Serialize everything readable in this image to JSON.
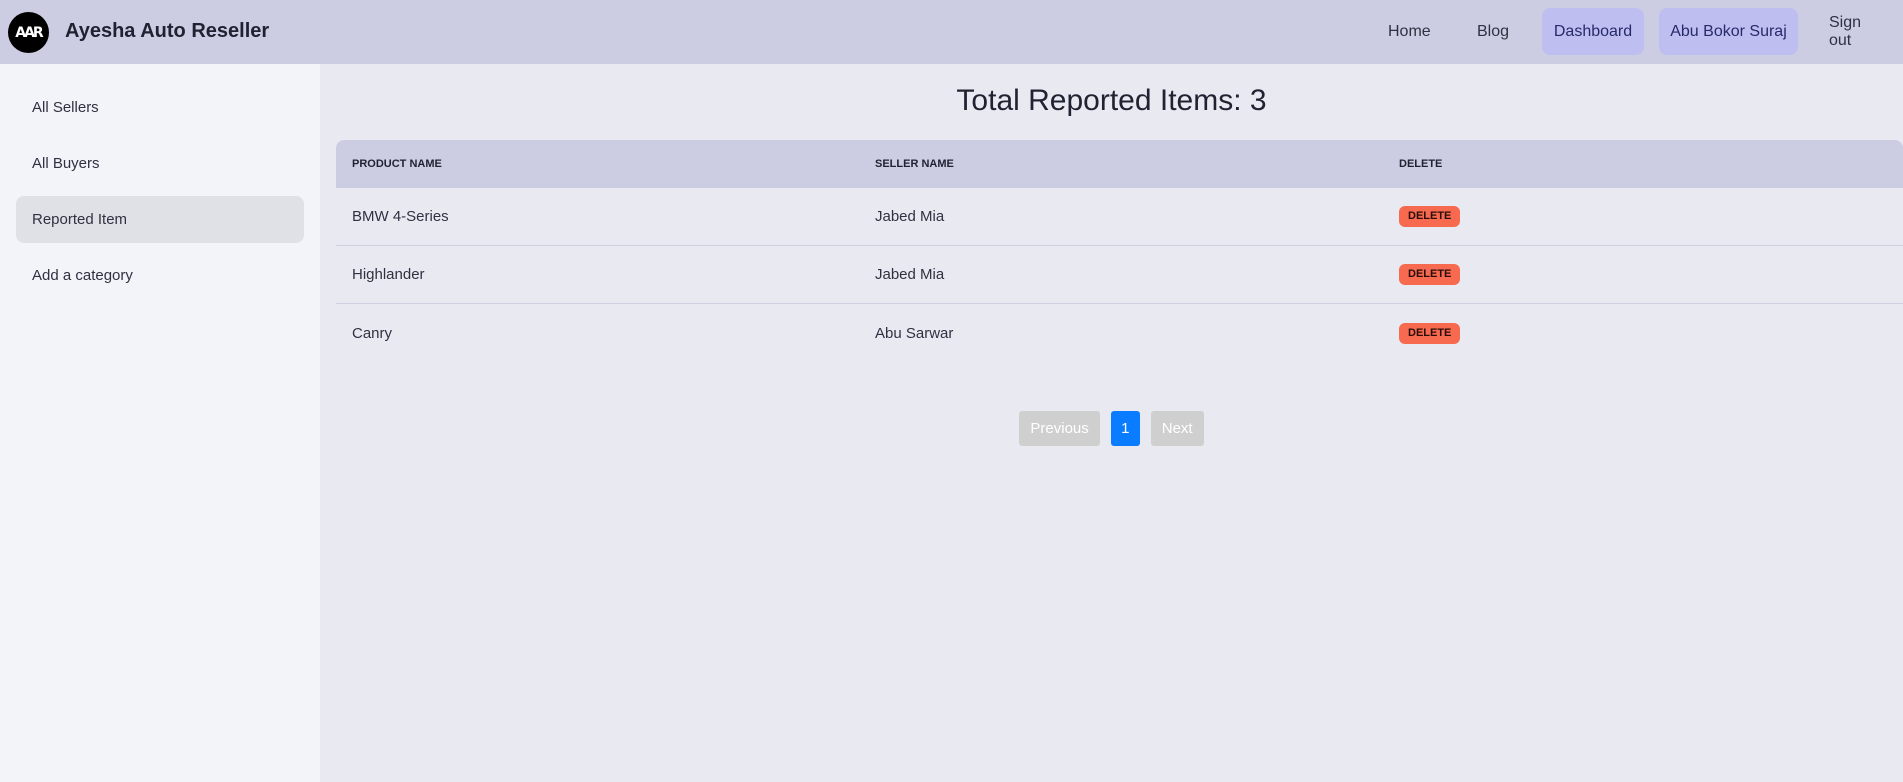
{
  "header": {
    "logo_text": "AAR",
    "brand": "Ayesha Auto Reseller",
    "nav": {
      "home": "Home",
      "blog": "Blog",
      "dashboard": "Dashboard",
      "user": "Abu Bokor Suraj",
      "signout": "Sign out"
    }
  },
  "sidebar": {
    "items": [
      {
        "label": "All Sellers"
      },
      {
        "label": "All Buyers"
      },
      {
        "label": "Reported Item"
      },
      {
        "label": "Add a category"
      }
    ]
  },
  "main": {
    "title": "Total Reported Items: 3",
    "table": {
      "headers": [
        "Product Name",
        "Seller Name",
        "Delete"
      ],
      "rows": [
        {
          "product": "BMW 4-Series",
          "seller": "Jabed Mia",
          "action": "Delete"
        },
        {
          "product": "Highlander",
          "seller": "Jabed Mia",
          "action": "Delete"
        },
        {
          "product": "Canry",
          "seller": "Abu Sarwar",
          "action": "Delete"
        }
      ]
    },
    "pagination": {
      "previous": "Previous",
      "current": "1",
      "next": "Next"
    }
  },
  "colors": {
    "navbar": "#cccde3",
    "active_nav": "#bebff0",
    "delete": "#f76a4f",
    "current_page": "#0a7cff"
  }
}
